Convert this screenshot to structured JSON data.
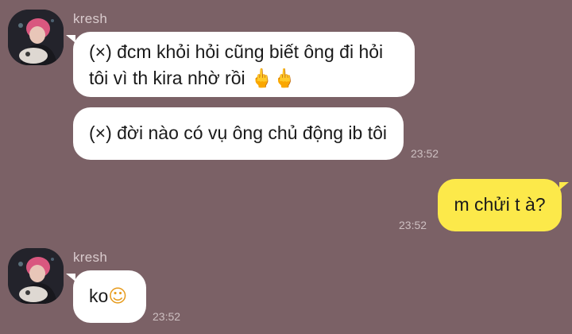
{
  "chat": {
    "messages": [
      {
        "sender": "kresh",
        "text_line1": "(×) đcm khỏi hỏi cũng biết ông đi hỏi",
        "text_line2": "tôi vì th kira nhờ rồi",
        "emoji": "🖕🖕"
      },
      {
        "text": "(×) đời nào có vụ ông chủ động ib tôi",
        "time": "23:52"
      },
      {
        "text": "m chửi t à?",
        "time": "23:52",
        "outgoing": true
      },
      {
        "sender": "kresh",
        "text": "ko",
        "emoji": "☺",
        "time": "23:52"
      }
    ]
  },
  "colors": {
    "background": "#7b6166",
    "incoming_bubble": "#ffffff",
    "outgoing_bubble": "#fce94a"
  },
  "icons": {
    "avatar": "profile-photo-icon"
  }
}
